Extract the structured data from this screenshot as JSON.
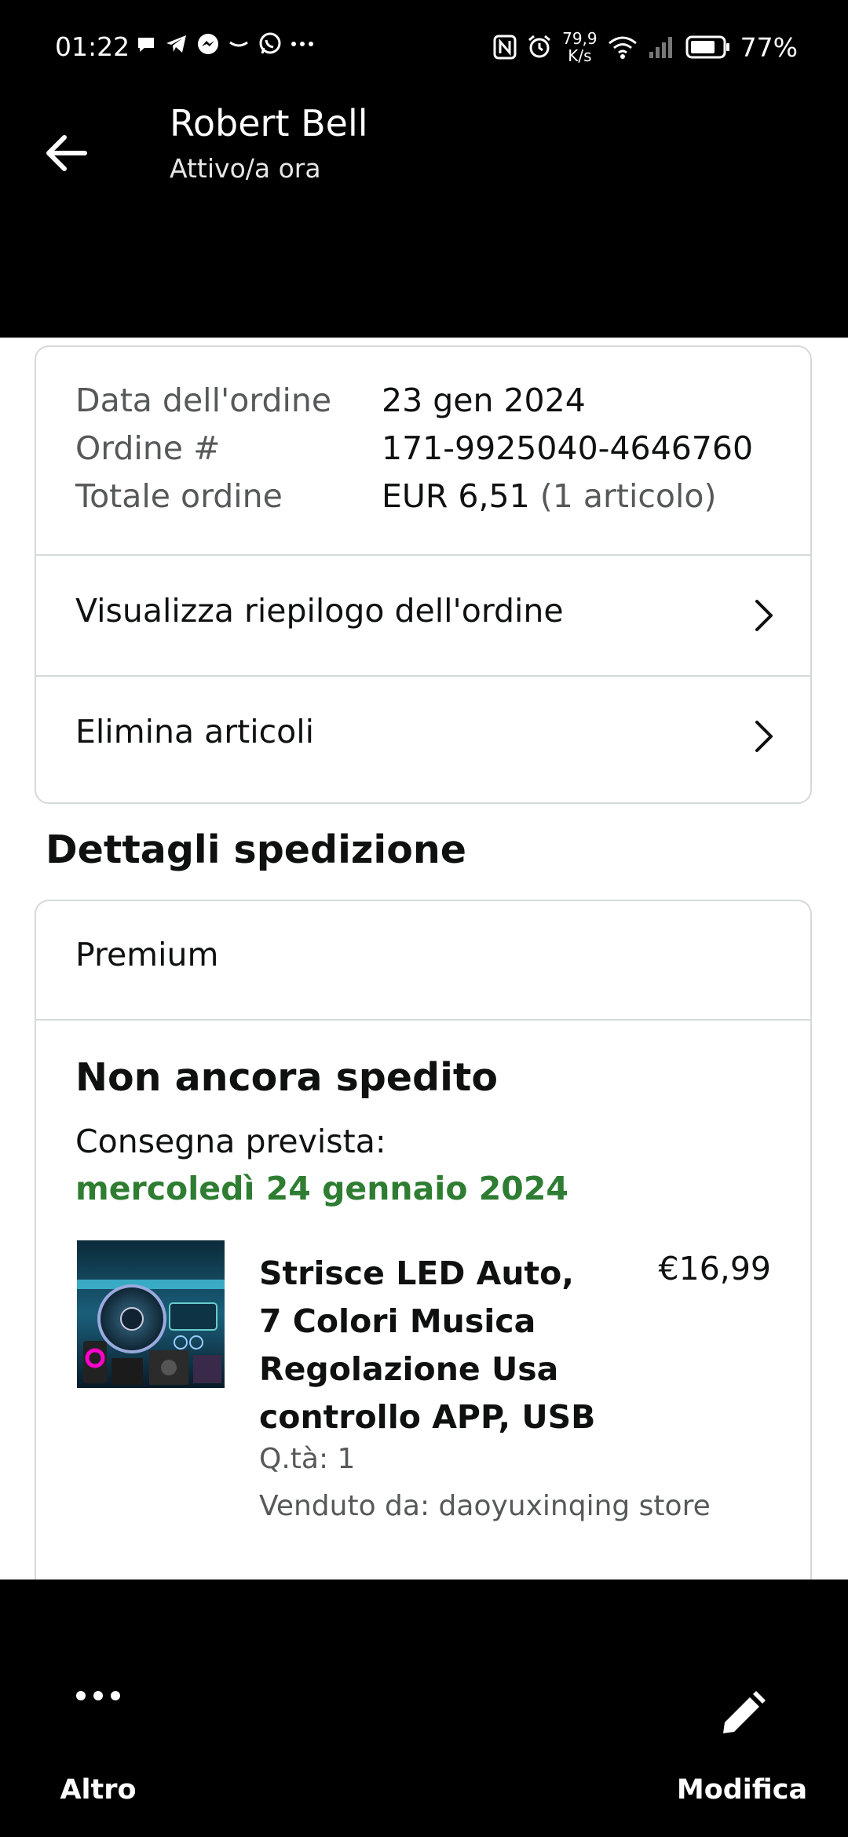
{
  "status_bar": {
    "time": "01:22",
    "net_speed_value": "79,9",
    "net_speed_unit": "K/s",
    "battery": "77%"
  },
  "header": {
    "contact_name": "Robert Bell",
    "contact_status": "Attivo/a ora"
  },
  "order": {
    "rows": [
      {
        "label": "Data dell'ordine",
        "value": "23 gen 2024"
      },
      {
        "label": "Ordine #",
        "value": "171-9925040-4646760"
      },
      {
        "label": "Totale ordine",
        "value": "EUR 6,51",
        "extra": "(1 articolo)"
      }
    ],
    "links": [
      {
        "label": "Visualizza riepilogo dell'ordine"
      },
      {
        "label": "Elimina articoli"
      }
    ]
  },
  "shipping": {
    "section_title": "Dettagli spedizione",
    "type": "Premium",
    "status": "Non ancora spedito",
    "delivery_label": "Consegna prevista:",
    "delivery_date": "mercoledì 24 gennaio 2024",
    "product": {
      "title": "Strisce LED Auto, 7 Colori Musica Regolazione Usa controllo APP, USB",
      "price": "€16,99",
      "quantity": "Q.tà: 1",
      "seller": "Venduto da: daoyuxinqing store"
    }
  },
  "bottom_bar": {
    "more_label": "Altro",
    "edit_label": "Modifica"
  },
  "colors": {
    "delivery_green": "#2e7d32",
    "border": "#d5d9d9",
    "secondary_text": "#565959"
  }
}
